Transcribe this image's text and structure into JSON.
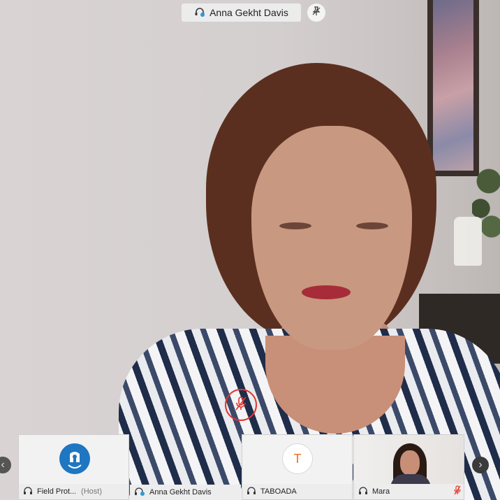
{
  "active_speaker": {
    "name": "Anna Gekht Davis"
  },
  "icons": {
    "headset": "headset-icon",
    "pin": "pin-icon",
    "mic_muted": "mic-muted-icon",
    "arrow_left": "chevron-left-icon",
    "arrow_right": "chevron-right-icon"
  },
  "arrows": {
    "left": "‹",
    "right": "›"
  },
  "participants": [
    {
      "name": "Field Prot...",
      "role": "(Host)",
      "avatar": "logo"
    },
    {
      "name": "Anna Gekht Davis",
      "avatar": "video-active"
    },
    {
      "name": "TABOADA",
      "avatar_letter": "T"
    },
    {
      "name": "Mara",
      "avatar": "video",
      "muted": true
    }
  ],
  "colors": {
    "mute_red": "#e0352d",
    "avatar_orange": "#f06e1d",
    "unhcr_blue": "#1f76c2"
  }
}
